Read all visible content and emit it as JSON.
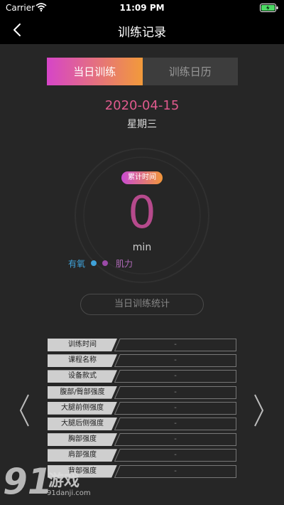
{
  "status": {
    "carrier": "Carrier",
    "time": "11:09 PM"
  },
  "nav": {
    "title": "训练记录"
  },
  "tabs": [
    {
      "label": "当日训练",
      "active": true
    },
    {
      "label": "训练日历",
      "active": false
    }
  ],
  "date": "2020-04-15",
  "weekday": "星期三",
  "badge": "累计时间",
  "total": {
    "value": "0",
    "unit": "min"
  },
  "legend": {
    "aerobic": "有氧",
    "strength": "肌力"
  },
  "stats_button": "当日训练统计",
  "table": [
    {
      "label": "训练时间",
      "value": "-"
    },
    {
      "label": "课程名称",
      "value": "-"
    },
    {
      "label": "设备款式",
      "value": "-"
    },
    {
      "label": "腹部/臀部强度",
      "value": "-"
    },
    {
      "label": "大腿前侧强度",
      "value": "-"
    },
    {
      "label": "大腿后侧强度",
      "value": "-"
    },
    {
      "label": "胸部强度",
      "value": "-"
    },
    {
      "label": "肩部强度",
      "value": "-"
    },
    {
      "label": "背部强度",
      "value": "-"
    }
  ],
  "watermark": {
    "number": "91",
    "title": "游戏",
    "url": "91danji.com"
  },
  "colors": {
    "accent_start": "#d645c8",
    "accent_end": "#f29a3a",
    "aerobic": "#3fa2d9",
    "strength": "#9b4aa8"
  }
}
